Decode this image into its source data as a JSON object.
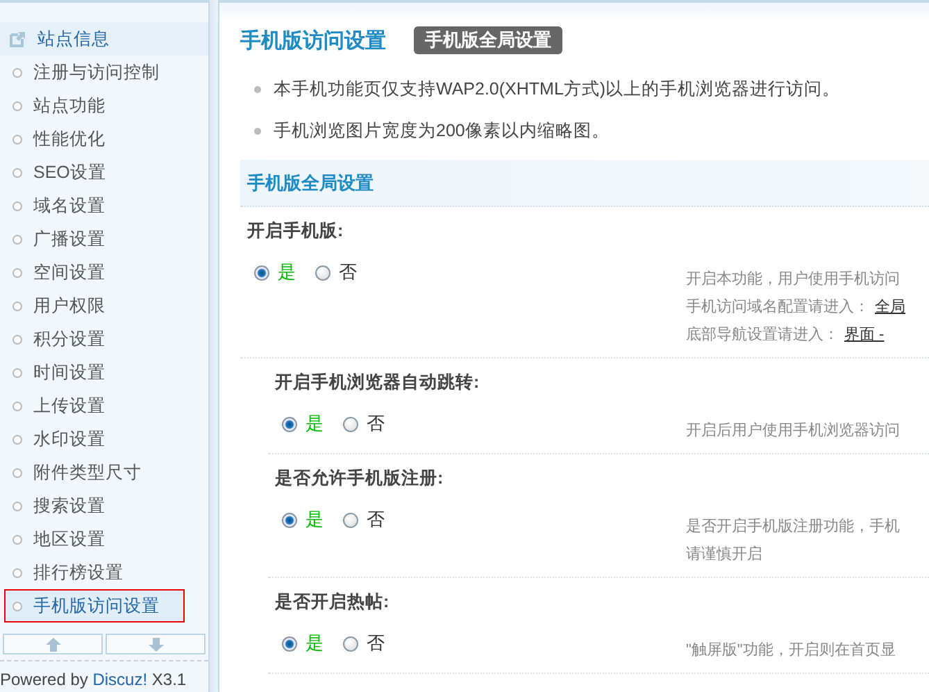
{
  "sidebar": {
    "items": [
      {
        "label": "站点信息",
        "kind": "header",
        "selected": false
      },
      {
        "label": "注册与访问控制",
        "kind": "item",
        "selected": false
      },
      {
        "label": "站点功能",
        "kind": "item",
        "selected": false
      },
      {
        "label": "性能优化",
        "kind": "item",
        "selected": false
      },
      {
        "label": "SEO设置",
        "kind": "item",
        "selected": false
      },
      {
        "label": "域名设置",
        "kind": "item",
        "selected": false
      },
      {
        "label": "广播设置",
        "kind": "item",
        "selected": false
      },
      {
        "label": "空间设置",
        "kind": "item",
        "selected": false
      },
      {
        "label": "用户权限",
        "kind": "item",
        "selected": false
      },
      {
        "label": "积分设置",
        "kind": "item",
        "selected": false
      },
      {
        "label": "时间设置",
        "kind": "item",
        "selected": false
      },
      {
        "label": "上传设置",
        "kind": "item",
        "selected": false
      },
      {
        "label": "水印设置",
        "kind": "item",
        "selected": false
      },
      {
        "label": "附件类型尺寸",
        "kind": "item",
        "selected": false
      },
      {
        "label": "搜索设置",
        "kind": "item",
        "selected": false
      },
      {
        "label": "地区设置",
        "kind": "item",
        "selected": false
      },
      {
        "label": "排行榜设置",
        "kind": "item",
        "selected": false
      },
      {
        "label": "手机版访问设置",
        "kind": "item",
        "selected": true
      }
    ],
    "footer": {
      "text": "Powered by",
      "link": "Discuz!",
      "version": "X3.1"
    }
  },
  "main": {
    "title": "手机版访问设置",
    "tab": "手机版全局设置",
    "notes": [
      "本手机功能页仅支持WAP2.0(XHTML方式)以上的手机浏览器进行访问。",
      "手机浏览图片宽度为200像素以内缩略图。"
    ],
    "section_title": "手机版全局设置",
    "settings": [
      {
        "label": "开启手机版:",
        "options": [
          {
            "label": "是",
            "selected": true
          },
          {
            "label": "否",
            "selected": false
          }
        ],
        "description": [
          {
            "text": "开启本功能，用户使用手机访问"
          },
          {
            "text": "手机访问域名配置请进入：",
            "link": "全局"
          },
          {
            "text": "底部导航设置请进入：",
            "link": "界面 -"
          }
        ],
        "children": [
          {
            "label": "开启手机浏览器自动跳转:",
            "options": [
              {
                "label": "是",
                "selected": true
              },
              {
                "label": "否",
                "selected": false
              }
            ],
            "description": [
              {
                "text": "开启后用户使用手机浏览器访问"
              }
            ]
          },
          {
            "label": "是否允许手机版注册:",
            "options": [
              {
                "label": "是",
                "selected": true
              },
              {
                "label": "否",
                "selected": false
              }
            ],
            "description": [
              {
                "text": "是否开启手机版注册功能，手机"
              },
              {
                "text": "请谨慎开启"
              }
            ]
          },
          {
            "label": "是否开启热帖:",
            "options": [
              {
                "label": "是",
                "selected": true
              },
              {
                "label": "否",
                "selected": false
              }
            ],
            "description": [
              {
                "text": "\"触屏版\"功能，开启则在首页显"
              }
            ]
          }
        ]
      }
    ]
  }
}
